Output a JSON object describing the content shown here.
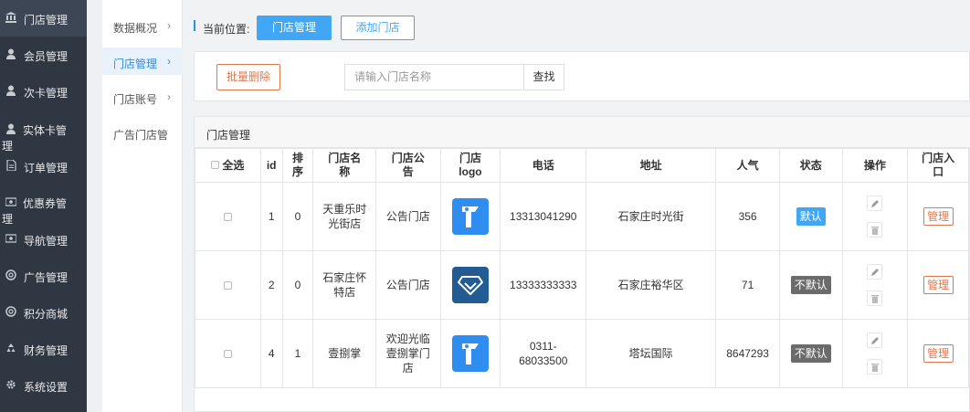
{
  "sidebar": {
    "items": [
      {
        "label": "门店管理",
        "icon": "bank-icon"
      },
      {
        "label": "会员管理",
        "icon": "user-icon"
      },
      {
        "label": "次卡管理",
        "icon": "user-icon"
      },
      {
        "label_a": "实体卡管",
        "label_b": "理",
        "icon": "user-icon"
      },
      {
        "label": "订单管理",
        "icon": "document-icon"
      },
      {
        "label_a": "优惠券管",
        "label_b": "理",
        "icon": "ticket-icon"
      },
      {
        "label": "导航管理",
        "icon": "ticket-icon"
      },
      {
        "label": "广告管理",
        "icon": "lifebuoy-icon"
      },
      {
        "label": "积分商城",
        "icon": "lifebuoy-icon"
      },
      {
        "label": "财务管理",
        "icon": "recycle-icon"
      },
      {
        "label": "系统设置",
        "icon": "gear-icon"
      }
    ]
  },
  "submenu": {
    "items": [
      {
        "label": "数据概况",
        "chevron": "›"
      },
      {
        "label": "门店管理",
        "chevron": "›"
      },
      {
        "label": "门店账号",
        "chevron": "›"
      },
      {
        "label": "广告门店管",
        "chevron": ""
      }
    ]
  },
  "breadcrumb": {
    "label": "当前位置:",
    "current": "门店管理",
    "add": "添加门店"
  },
  "toolbar": {
    "batch_delete": "批量删除",
    "search_placeholder": "请输入门店名称",
    "search_button": "查找"
  },
  "panel": {
    "title": "门店管理"
  },
  "table": {
    "headers": {
      "select_all": "全选",
      "id": "id",
      "sort_a": "排",
      "sort_b": "序",
      "name_a": "门店名",
      "name_b": "称",
      "notice_a": "门店公",
      "notice_b": "告",
      "logo_a": "门店",
      "logo_b": "logo",
      "phone": "电话",
      "address": "地址",
      "popularity": "人气",
      "status": "状态",
      "action": "操作",
      "entry_a": "门店入",
      "entry_b": "口"
    },
    "rows": [
      {
        "id": "1",
        "sort": "0",
        "name_a": "天重乐时",
        "name_b": "光街店",
        "notice": "公告门店",
        "logo": "blue-badge-logo",
        "phone": "13313041290",
        "address": "石家庄时光街",
        "popularity": "356",
        "status": "默认",
        "manage": "管理"
      },
      {
        "id": "2",
        "sort": "0",
        "name_a": "石家庄怀",
        "name_b": "特店",
        "notice": "公告门店",
        "logo": "blue-gem-logo",
        "phone": "13333333333",
        "address": "石家庄裕华区",
        "popularity": "71",
        "status": "不默认",
        "manage": "管理"
      },
      {
        "id": "4",
        "sort": "1",
        "name_a": "壹捌掌",
        "name_b": "",
        "notice_a": "欢迎光临",
        "notice_b": "壹捌掌门",
        "notice_c": "店",
        "logo": "blue-badge-logo",
        "phone_a": "0311-",
        "phone_b": "68033500",
        "address": "塔坛国际",
        "popularity": "8647293",
        "status": "不默认",
        "manage": "管理"
      }
    ]
  },
  "colors": {
    "sidebar_bg": "#2f3742",
    "accent_blue": "#41a7f5",
    "accent_orange": "#e0774d",
    "status_gray": "#6b6b6b"
  }
}
